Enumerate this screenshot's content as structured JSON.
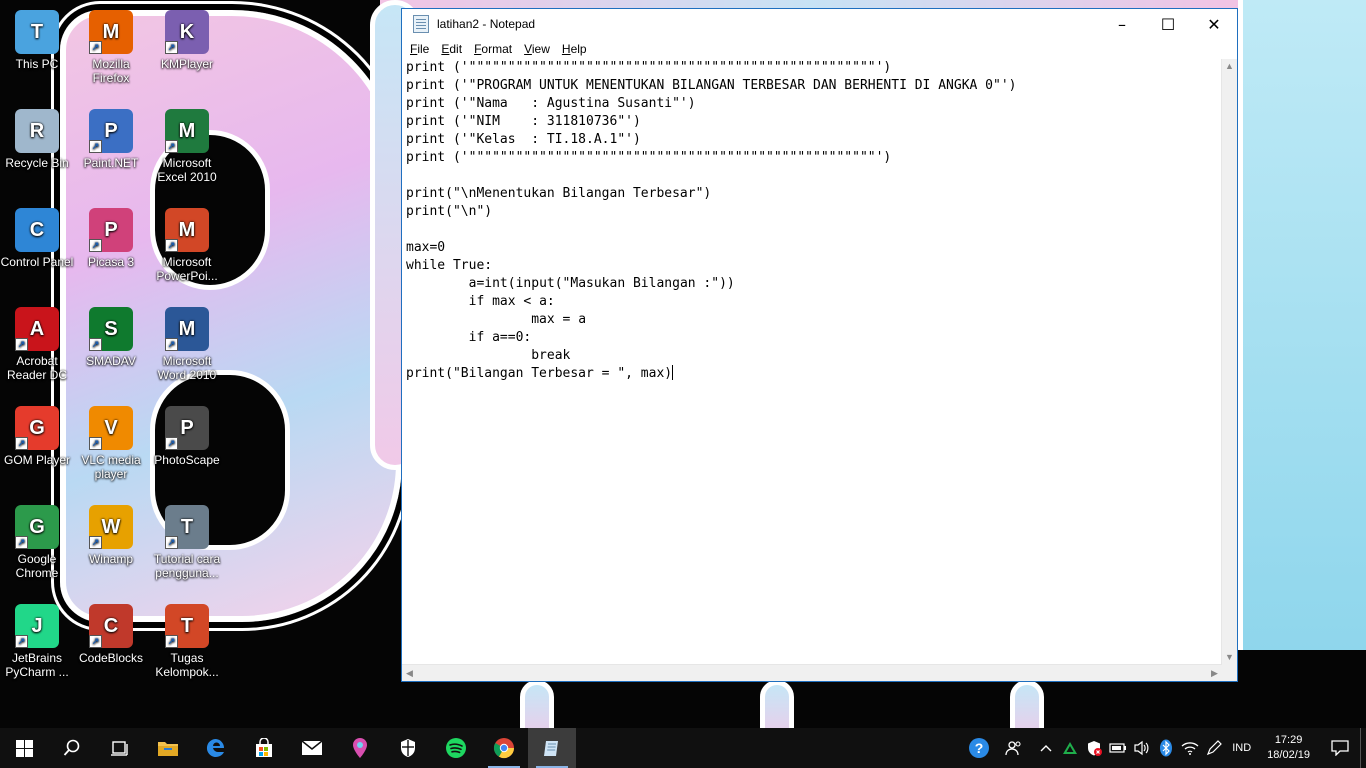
{
  "desktop": {
    "icons": [
      {
        "label": "This PC",
        "icon": "computer-icon",
        "color": "#4aa3df"
      },
      {
        "label": "Mozilla Firefox",
        "icon": "firefox-icon",
        "color": "#e66000"
      },
      {
        "label": "KMPlayer",
        "icon": "kmplayer-icon",
        "color": "#7b5fb0"
      },
      {
        "label": "Recycle Bin",
        "icon": "recycle-bin-icon",
        "color": "#9fb7cc"
      },
      {
        "label": "Paint.NET",
        "icon": "paintnet-icon",
        "color": "#3b6fc4"
      },
      {
        "label": "Microsoft Excel 2010",
        "icon": "excel-icon",
        "color": "#1f7a3e"
      },
      {
        "label": "Control Panel",
        "icon": "control-panel-icon",
        "color": "#2e86d6"
      },
      {
        "label": "Picasa 3",
        "icon": "picasa-icon",
        "color": "#d0417a"
      },
      {
        "label": "Microsoft PowerPoi...",
        "icon": "powerpoint-icon",
        "color": "#d24726"
      },
      {
        "label": "Acrobat Reader DC",
        "icon": "acrobat-icon",
        "color": "#c9141b"
      },
      {
        "label": "SMADAV",
        "icon": "smadav-icon",
        "color": "#0f7a2e"
      },
      {
        "label": "Microsoft Word 2010",
        "icon": "word-icon",
        "color": "#2b5797"
      },
      {
        "label": "GOM Player",
        "icon": "gom-player-icon",
        "color": "#e53b2c"
      },
      {
        "label": "VLC media player",
        "icon": "vlc-icon",
        "color": "#f08a00"
      },
      {
        "label": "PhotoScape",
        "icon": "photoscape-icon",
        "color": "#4a4a4a"
      },
      {
        "label": "Google Chrome",
        "icon": "chrome-icon",
        "color": "#2c9a4b"
      },
      {
        "label": "Winamp",
        "icon": "winamp-icon",
        "color": "#e7a100"
      },
      {
        "label": "Tutorial cara pengguna...",
        "icon": "search-file-icon",
        "color": "#6b7d8c"
      },
      {
        "label": "JetBrains PyCharm ...",
        "icon": "pycharm-icon",
        "color": "#21d789"
      },
      {
        "label": "CodeBlocks",
        "icon": "codeblocks-icon",
        "color": "#c0392b"
      },
      {
        "label": "Tugas Kelompok...",
        "icon": "pptx-file-icon",
        "color": "#d24726"
      }
    ]
  },
  "notepad": {
    "title": "latihan2 - Notepad",
    "menu": [
      "File",
      "Edit",
      "Format",
      "View",
      "Help"
    ],
    "content": "print ('\"\"\"\"\"\"\"\"\"\"\"\"\"\"\"\"\"\"\"\"\"\"\"\"\"\"\"\"\"\"\"\"\"\"\"\"\"\"\"\"\"\"\"\"\"\"\"\"\"\"\"\"')\nprint ('\"PROGRAM UNTUK MENENTUKAN BILANGAN TERBESAR DAN BERHENTI DI ANGKA 0\"')\nprint ('\"Nama   : Agustina Susanti\"')\nprint ('\"NIM    : 311810736\"')\nprint ('\"Kelas  : TI.18.A.1\"')\nprint ('\"\"\"\"\"\"\"\"\"\"\"\"\"\"\"\"\"\"\"\"\"\"\"\"\"\"\"\"\"\"\"\"\"\"\"\"\"\"\"\"\"\"\"\"\"\"\"\"\"\"\"\"')\n\nprint(\"\\nMenentukan Bilangan Terbesar\")\nprint(\"\\n\")\n\nmax=0\nwhile True:\n\ta=int(input(\"Masukan Bilangan :\"))\n\tif max < a:\n\t\tmax = a\n\tif a==0:\n\t\tbreak\nprint(\"Bilangan Terbesar = \", max)"
  },
  "taskbar": {
    "apps": [
      {
        "name": "start-button",
        "icon": "windows-icon"
      },
      {
        "name": "search-button",
        "icon": "search-icon"
      },
      {
        "name": "task-view-button",
        "icon": "task-view-icon"
      },
      {
        "name": "file-explorer-button",
        "icon": "folder-icon"
      },
      {
        "name": "edge-button",
        "icon": "edge-icon"
      },
      {
        "name": "store-button",
        "icon": "store-icon"
      },
      {
        "name": "mail-button",
        "icon": "mail-icon"
      },
      {
        "name": "maps-button",
        "icon": "maps-icon"
      },
      {
        "name": "defender-button",
        "icon": "shield-icon"
      },
      {
        "name": "spotify-button",
        "icon": "spotify-icon"
      },
      {
        "name": "chrome-button",
        "icon": "chrome-icon"
      },
      {
        "name": "notepad-button",
        "icon": "notepad-icon"
      }
    ],
    "language": "IND",
    "time": "17:29",
    "date": "18/02/19"
  }
}
